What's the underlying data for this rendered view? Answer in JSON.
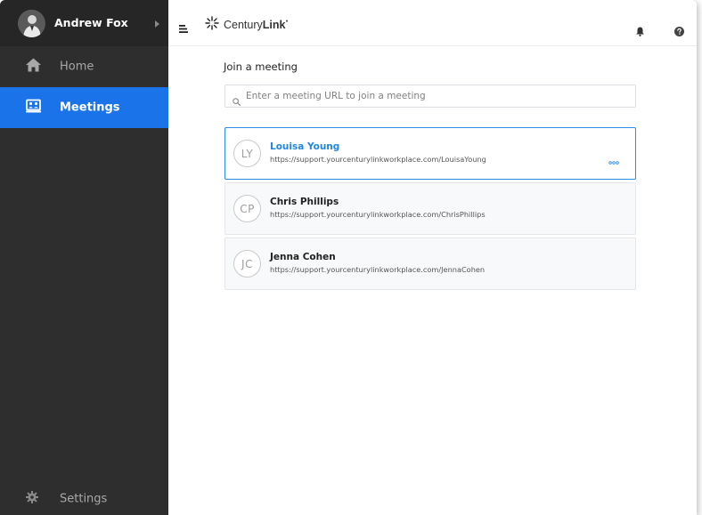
{
  "sidebar": {
    "user_name": "Andrew Fox",
    "items": [
      {
        "label": "Home",
        "icon": "home-icon"
      },
      {
        "label": "Meetings",
        "icon": "meetings-icon",
        "active": true
      }
    ],
    "settings_label": "Settings"
  },
  "header": {
    "logo_prefix": "Century",
    "logo_bold": "Link",
    "icons": [
      "menu-icon",
      "bell-icon",
      "help-icon"
    ]
  },
  "main": {
    "title": "Join a meeting",
    "search_placeholder": "Enter a meeting URL to join a meeting",
    "meetings": [
      {
        "initials": "LY",
        "name": "Louisa Young",
        "url": "https://support.yourcenturylinkworkplace.com/LouisaYoung",
        "active": true
      },
      {
        "initials": "CP",
        "name": "Chris Phillips",
        "url": "https://support.yourcenturylinkworkplace.com/ChrisPhillips"
      },
      {
        "initials": "JC",
        "name": "Jenna Cohen",
        "url": "https://support.yourcenturylinkworkplace.com/JennaCohen"
      }
    ]
  },
  "colors": {
    "accent": "#1a73e8",
    "sidebar_bg": "#2e2e2e",
    "active_border": "#2a8ee8"
  }
}
